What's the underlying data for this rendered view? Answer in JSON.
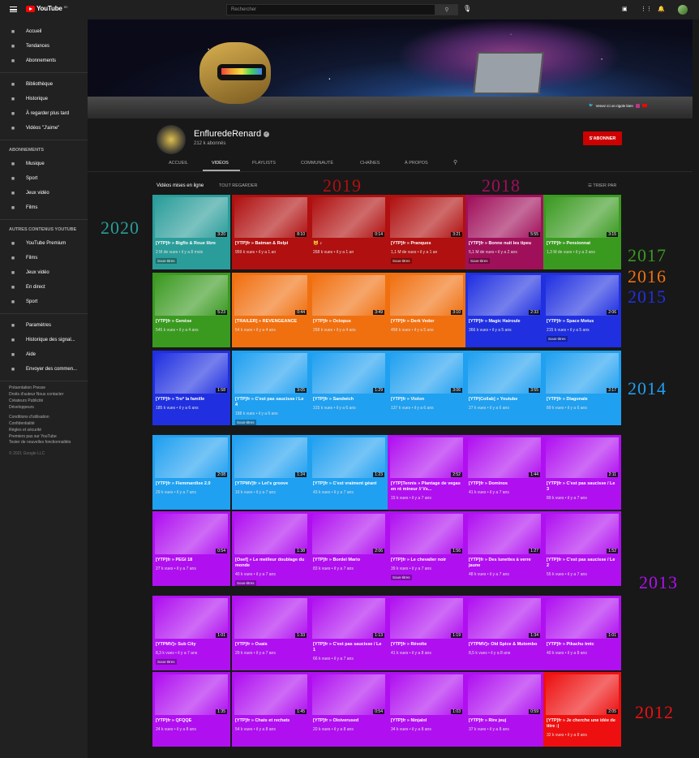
{
  "header": {
    "logo_text": "YouTube",
    "logo_sup": "BE",
    "search_placeholder": "Rechercher"
  },
  "sidebar": {
    "main": [
      {
        "label": "Accueil",
        "icon": "home-icon"
      },
      {
        "label": "Tendances",
        "icon": "fire-icon"
      },
      {
        "label": "Abonnements",
        "icon": "subscriptions-icon"
      }
    ],
    "library": [
      {
        "label": "Bibliothèque",
        "icon": "library-icon"
      },
      {
        "label": "Historique",
        "icon": "history-icon"
      },
      {
        "label": "À regarder plus tard",
        "icon": "clock-icon"
      },
      {
        "label": "Vidéos \"J'aime\"",
        "icon": "thumb-up-icon"
      }
    ],
    "subs_heading": "ABONNEMENTS",
    "subs": [
      {
        "label": "Musique",
        "icon": "music-icon"
      },
      {
        "label": "Sport",
        "icon": "trophy-icon"
      },
      {
        "label": "Jeux vidéo",
        "icon": "gamepad-icon"
      },
      {
        "label": "Films",
        "icon": "film-icon"
      }
    ],
    "more_heading": "AUTRES CONTENUS YOUTUBE",
    "more": [
      {
        "label": "YouTube Premium",
        "icon": "youtube-icon"
      },
      {
        "label": "Films",
        "icon": "film-icon"
      },
      {
        "label": "Jeux vidéo",
        "icon": "gamepad-icon"
      },
      {
        "label": "En direct",
        "icon": "live-icon"
      },
      {
        "label": "Sport",
        "icon": "trophy-icon"
      }
    ],
    "settings": [
      {
        "label": "Paramètres",
        "icon": "gear-icon"
      },
      {
        "label": "Historique des signal...",
        "icon": "flag-icon"
      },
      {
        "label": "Aide",
        "icon": "help-icon"
      },
      {
        "label": "Envoyer des commen...",
        "icon": "feedback-icon"
      }
    ],
    "footer1": [
      "Présentation  Presse",
      "Droits d'auteur  Nous contacter",
      "Créateurs  Publicité",
      "Développeurs"
    ],
    "footer2": [
      "Conditions d'utilisation",
      "Confidentialité",
      "Règles et sécurité",
      "Premiers pas sur YouTube",
      "Tester de nouvelles fonctionnalités"
    ],
    "copyright": "© 2021 Google LLC"
  },
  "banner": {
    "tagline": "Venez ici on rigole bien"
  },
  "channel": {
    "name": "EnfluredeRenard",
    "subscribers": "212 k abonnés",
    "subscribe_label": "S'ABONNER"
  },
  "tabs": [
    {
      "label": "ACCUEIL"
    },
    {
      "label": "VIDÉOS"
    },
    {
      "label": "PLAYLISTS"
    },
    {
      "label": "COMMUNAUTÉ"
    },
    {
      "label": "CHAÎNES"
    },
    {
      "label": "À PROPOS"
    }
  ],
  "section": {
    "title": "Vidéos mises en ligne",
    "all": "TOUT REGARDER",
    "sort": "TRIER PAR"
  },
  "years": [
    {
      "label": "2020",
      "color": "#2a9d9a"
    },
    {
      "label": "2019",
      "color": "#b01010"
    },
    {
      "label": "2018",
      "color": "#a0105a"
    },
    {
      "label": "2017",
      "color": "#3a9a20"
    },
    {
      "label": "2016",
      "color": "#f07010"
    },
    {
      "label": "2015",
      "color": "#2030e0"
    },
    {
      "label": "2014",
      "color": "#20a0f0"
    },
    {
      "label": "2013",
      "color": "#b010f0"
    },
    {
      "label": "2012",
      "color": "#ee1010"
    }
  ],
  "videos": [
    {
      "title": "[YTP]fr » Bigflo & Roue libre",
      "meta": "2 M de vues • il y a 8 mois",
      "duration": "3:20",
      "cc": "Sous-titres",
      "color": "#2a9d9a"
    },
    {
      "title": "[YTP]fr » Batman & Relpi",
      "meta": "959 k vues • il y a 1 an",
      "duration": "8:10",
      "cc": "",
      "color": "#b01010"
    },
    {
      "title": "🐱 ♪",
      "meta": "268 k vues • il y a 1 an",
      "duration": "0:14",
      "cc": "",
      "color": "#b01010"
    },
    {
      "title": "[YTP]fr » Pranques",
      "meta": "1,1 M de vues • il y a 1 an",
      "duration": "3:21",
      "cc": "Sous-titres",
      "color": "#b01010"
    },
    {
      "title": "[YTP]fr » Bonne nuit les tipeu",
      "meta": "5,1 M de vues • il y a 2 ans",
      "duration": "5:55",
      "cc": "Sous-titres",
      "color": "#a0105a"
    },
    {
      "title": "[YTP]fr » Pensionnat",
      "meta": "1,3 M de vues • il y a 3 ans",
      "duration": "3:15",
      "cc": "",
      "color": "#3a9a20"
    },
    {
      "title": "[YTP]fr » Genèse",
      "meta": "545 k vues • il y a 4 ans",
      "duration": "5:23",
      "cc": "",
      "color": "#3a9a20"
    },
    {
      "title": "[TRAILER] » REVENGEANCE",
      "meta": "54 k vues • il y a 4 ans",
      "duration": "0:44",
      "cc": "",
      "color": "#f07010"
    },
    {
      "title": "[YTP]fr » Octopus",
      "meta": "268 k vues • il y a 4 ans",
      "duration": "3:49",
      "cc": "",
      "color": "#f07010"
    },
    {
      "title": "[YTP]fr » Derk Vedor",
      "meta": "458 k vues • il y a 5 ans",
      "duration": "3:10",
      "cc": "",
      "color": "#f07010"
    },
    {
      "title": "[YTP]fr » Magic Hairoule",
      "meta": "366 k vues • il y a 5 ans",
      "duration": "2:33",
      "cc": "",
      "color": "#2030e0"
    },
    {
      "title": "[YTP]fr » Space Motus",
      "meta": "215 k vues • il y a 5 ans",
      "duration": "2:06",
      "cc": "Sous-titres",
      "color": "#2030e0"
    },
    {
      "title": "[YTP]fr » Tro* la famille",
      "meta": "185 k vues • il y a 6 ans",
      "duration": "1:58",
      "cc": "",
      "color": "#2030e0"
    },
    {
      "title": "[YTP]fr » C'est pas saucisse / Le 4",
      "meta": "188 k vues • il y a 6 ans",
      "duration": "3:05",
      "cc": "Sous-titres",
      "color": "#20a0f0"
    },
    {
      "title": "[YTP]fr » Sandwich",
      "meta": "315 k vues • il y a 6 ans",
      "duration": "1:29",
      "cc": "",
      "color": "#20a0f0"
    },
    {
      "title": "[YTP]fr » Violon",
      "meta": "137 k vues • il y a 6 ans",
      "duration": "3:06",
      "cc": "",
      "color": "#20a0f0"
    },
    {
      "title": "[YTP|Collab] » Youtube",
      "meta": "27 k vues • il y a 6 ans",
      "duration": "3:55",
      "cc": "",
      "color": "#20a0f0"
    },
    {
      "title": "[YTP]fr » Diagonale",
      "meta": "89 k vues • il y a 6 ans",
      "duration": "2:17",
      "cc": "",
      "color": "#20a0f0"
    },
    {
      "title": "[YTP]fr » Flemmardise 2.0",
      "meta": "29 k vues • il y a 7 ans",
      "duration": "2:08",
      "cc": "",
      "color": "#20a0f0"
    },
    {
      "title": "[YTPMV]fr » Let's groove",
      "meta": "16 k vues • il y a 7 ans",
      "duration": "1:24",
      "cc": "",
      "color": "#20a0f0"
    },
    {
      "title": "[YTP]fr » C'est vraiment géant",
      "meta": "43 k vues • il y a 7 ans",
      "duration": "1:23",
      "cc": "",
      "color": "#20a0f0"
    },
    {
      "title": "[YTP]Tennis » Plantage de vegas en ré mineur // Vs...",
      "meta": "15 k vues • il y a 7 ans",
      "duration": "2:52",
      "cc": "",
      "color": "#b010f0"
    },
    {
      "title": "[YTP]fr » Dominos",
      "meta": "41 k vues • il y a 7 ans",
      "duration": "1:44",
      "cc": "",
      "color": "#b010f0"
    },
    {
      "title": "[YTP]fr » C'est pas saucisse / Le 3",
      "meta": "89 k vues • il y a 7 ans",
      "duration": "2:11",
      "cc": "",
      "color": "#b010f0"
    },
    {
      "title": "[YTP]fr » PEGI 18",
      "meta": "27 k vues • il y a 7 ans",
      "duration": "0:54",
      "cc": "",
      "color": "#b010f0"
    },
    {
      "title": "[Osef] » Le meilleur doublage du monde",
      "meta": "40 k vues • il y a 7 ans",
      "duration": "1:38",
      "cc": "Sous-titres",
      "color": "#b010f0"
    },
    {
      "title": "[YTP]fr » Bordel Mario",
      "meta": "83 k vues • il y a 7 ans",
      "duration": "2:06",
      "cc": "",
      "color": "#b010f0"
    },
    {
      "title": "[YTP]fr » Le chevalier noir",
      "meta": "39 k vues • il y a 7 ans",
      "duration": "1:56",
      "cc": "Sous-titres",
      "color": "#b010f0"
    },
    {
      "title": "[YTP]fr » Des lunettes à verre jaune",
      "meta": "48 k vues • il y a 7 ans",
      "duration": "1:27",
      "cc": "",
      "color": "#b010f0"
    },
    {
      "title": "[YTP]fr » C'est pas saucisse / Le 2",
      "meta": "55 k vues • il y a 7 ans",
      "duration": "1:52",
      "cc": "",
      "color": "#b010f0"
    },
    {
      "title": "[YTPMV]» Sub City",
      "meta": "8,3 k vues • il y a 7 ans",
      "duration": "1:01",
      "cc": "Sous-titres",
      "color": "#b010f0"
    },
    {
      "title": "[YTP]fr » Ouais",
      "meta": "29 k vues • il y a 7 ans",
      "duration": "1:33",
      "cc": "",
      "color": "#b010f0"
    },
    {
      "title": "[YTP]fr » C'est pas saucisse / Le 1",
      "meta": "66 k vues • il y a 7 ans",
      "duration": "1:13",
      "cc": "",
      "color": "#b010f0"
    },
    {
      "title": "[YTP]fr » Révolte",
      "meta": "41 k vues • il y a 8 ans",
      "duration": "1:19",
      "cc": "",
      "color": "#b010f0"
    },
    {
      "title": "[YTPMV]» Old Spice & Mutombo",
      "meta": "8,5 k vues • il y a 8 ans",
      "duration": "1:34",
      "cc": "",
      "color": "#b010f0"
    },
    {
      "title": "[YTP]fr » Pikachu tmtc",
      "meta": "40 k vues • il y a 8 ans",
      "duration": "1:01",
      "cc": "",
      "color": "#b010f0"
    },
    {
      "title": "[YTP]fr » QFQQE",
      "meta": "24 k vues • il y a 8 ans",
      "duration": "1:35",
      "cc": "",
      "color": "#b010f0"
    },
    {
      "title": "[YTP]fr » Chats et rechats",
      "meta": "54 k vues • il y a 8 ans",
      "duration": "1:45",
      "cc": "",
      "color": "#b010f0"
    },
    {
      "title": "[YTP]fr » Oloiverused",
      "meta": "20 k vues • il y a 8 ans",
      "duration": "0:54",
      "cc": "",
      "color": "#b010f0"
    },
    {
      "title": "[YTP]fr » Ninjalol",
      "meta": "34 k vues • il y a 8 ans",
      "duration": "1:03",
      "cc": "",
      "color": "#b010f0"
    },
    {
      "title": "[YTP]fr » Rire jeuj",
      "meta": "37 k vues • il y a 8 ans",
      "duration": "0:59",
      "cc": "",
      "color": "#b010f0"
    },
    {
      "title": "[YTP]fr » Je cherche une idée de titre :|",
      "meta": "32 k vues • il y a 8 ans",
      "duration": "2:05",
      "cc": "",
      "color": "#ee1010"
    }
  ]
}
